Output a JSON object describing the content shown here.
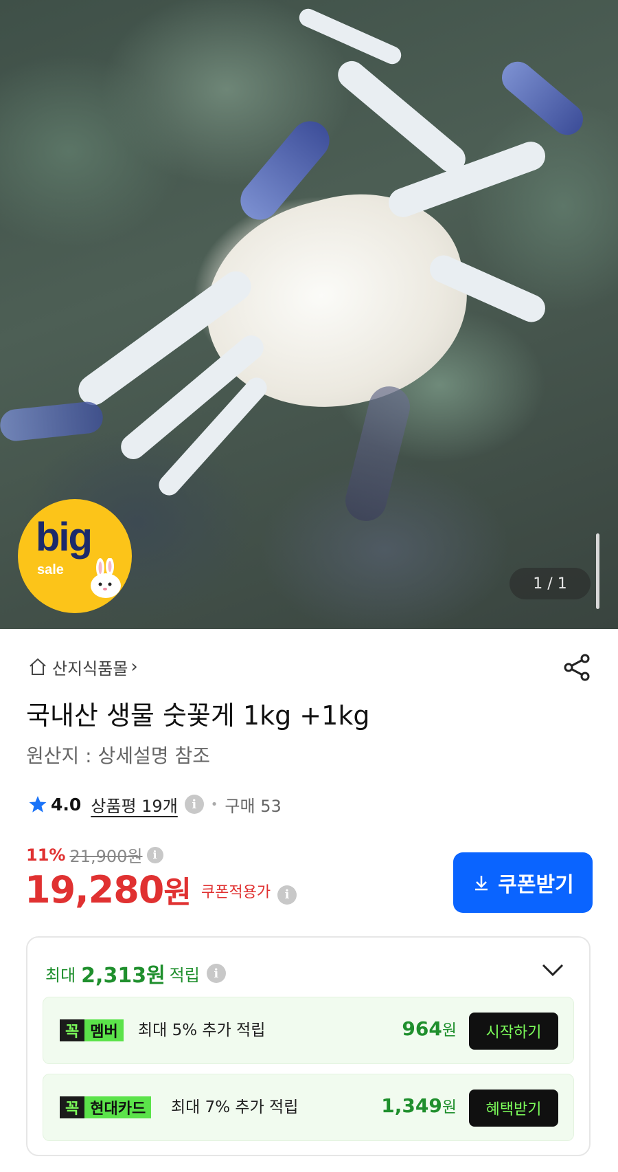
{
  "hero": {
    "badge_big": "big",
    "badge_sale": "sale",
    "counter": "1 / 1"
  },
  "store": {
    "name": "산지식품몰",
    "chevron": "›"
  },
  "product": {
    "title": "국내산 생물 숫꽃게 1kg +1kg",
    "origin": "원산지 : 상세설명 참조",
    "rating": "4.0",
    "reviews": "상품평 19개",
    "purchases": "구매 53",
    "discount_pct": "11%",
    "original_price": "21,900원",
    "price": "19,280",
    "currency": "원",
    "coupon_applied": "쿠폰적용가",
    "coupon_button": "쿠폰받기"
  },
  "points": {
    "prefix": "최대",
    "amount": "2,313원",
    "suffix": "적립",
    "benefits": [
      {
        "badge1": "꼭",
        "badge2": "멤버",
        "desc": "최대 5% 추가 적립",
        "amount": "964",
        "unit": "원",
        "action": "시작하기"
      },
      {
        "badge1": "꼭",
        "badge2": "현대카드",
        "desc": "최대 7% 추가 적립",
        "amount": "1,349",
        "unit": "원",
        "action": "혜택받기"
      }
    ]
  },
  "colors": {
    "price_red": "#e03131",
    "coupon_blue": "#0a64ff",
    "points_green": "#1f8f2d",
    "badge_yellow": "#fcc419"
  },
  "icons": [
    "home-icon",
    "share-icon",
    "star-icon",
    "info-icon",
    "download-icon",
    "chevron-down-icon",
    "bunny-icon"
  ]
}
